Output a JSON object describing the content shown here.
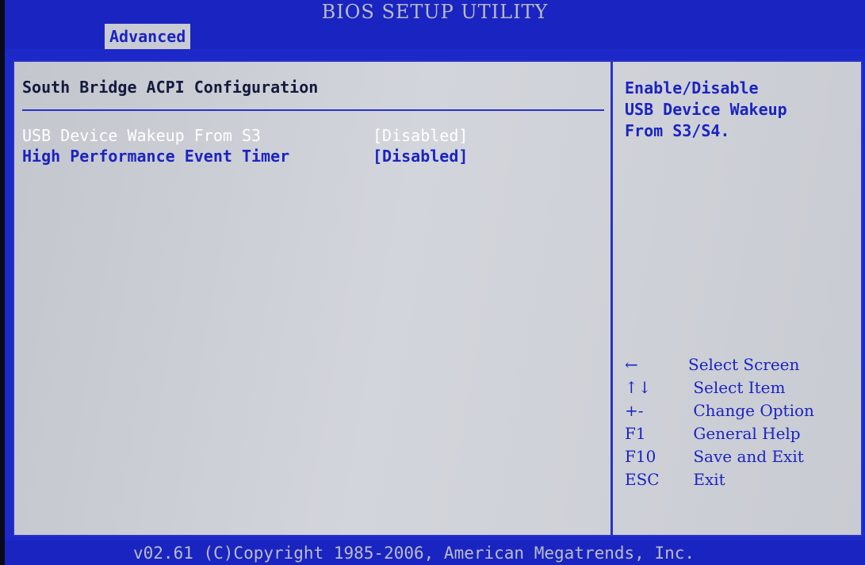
{
  "header": {
    "title": "BIOS SETUP UTILITY"
  },
  "tabs": [
    {
      "label": "Advanced"
    }
  ],
  "main": {
    "section_title": "South Bridge ACPI Configuration",
    "settings": [
      {
        "label": "USB Device Wakeup From S3",
        "value": "[Disabled]"
      },
      {
        "label": "High Performance Event Timer",
        "value": "[Disabled]"
      }
    ]
  },
  "help": {
    "lines": [
      "Enable/Disable",
      "USB Device Wakeup",
      "From S3/S4."
    ]
  },
  "keys": [
    {
      "key": "←",
      "desc": "Select Screen"
    },
    {
      "key": "↑↓",
      "desc": " Select Item"
    },
    {
      "key": "+-",
      "desc": " Change Option"
    },
    {
      "key": "F1",
      "desc": " General Help"
    },
    {
      "key": "F10",
      "desc": " Save and Exit"
    },
    {
      "key": "ESC",
      "desc": " Exit"
    }
  ],
  "footer": {
    "text": "v02.61 (C)Copyright 1985-2006, American Megatrends, Inc."
  },
  "colors": {
    "bios_blue": "#1a24c0",
    "panel_gray": "#cfd1d8",
    "highlight_text": "#ffffff"
  }
}
